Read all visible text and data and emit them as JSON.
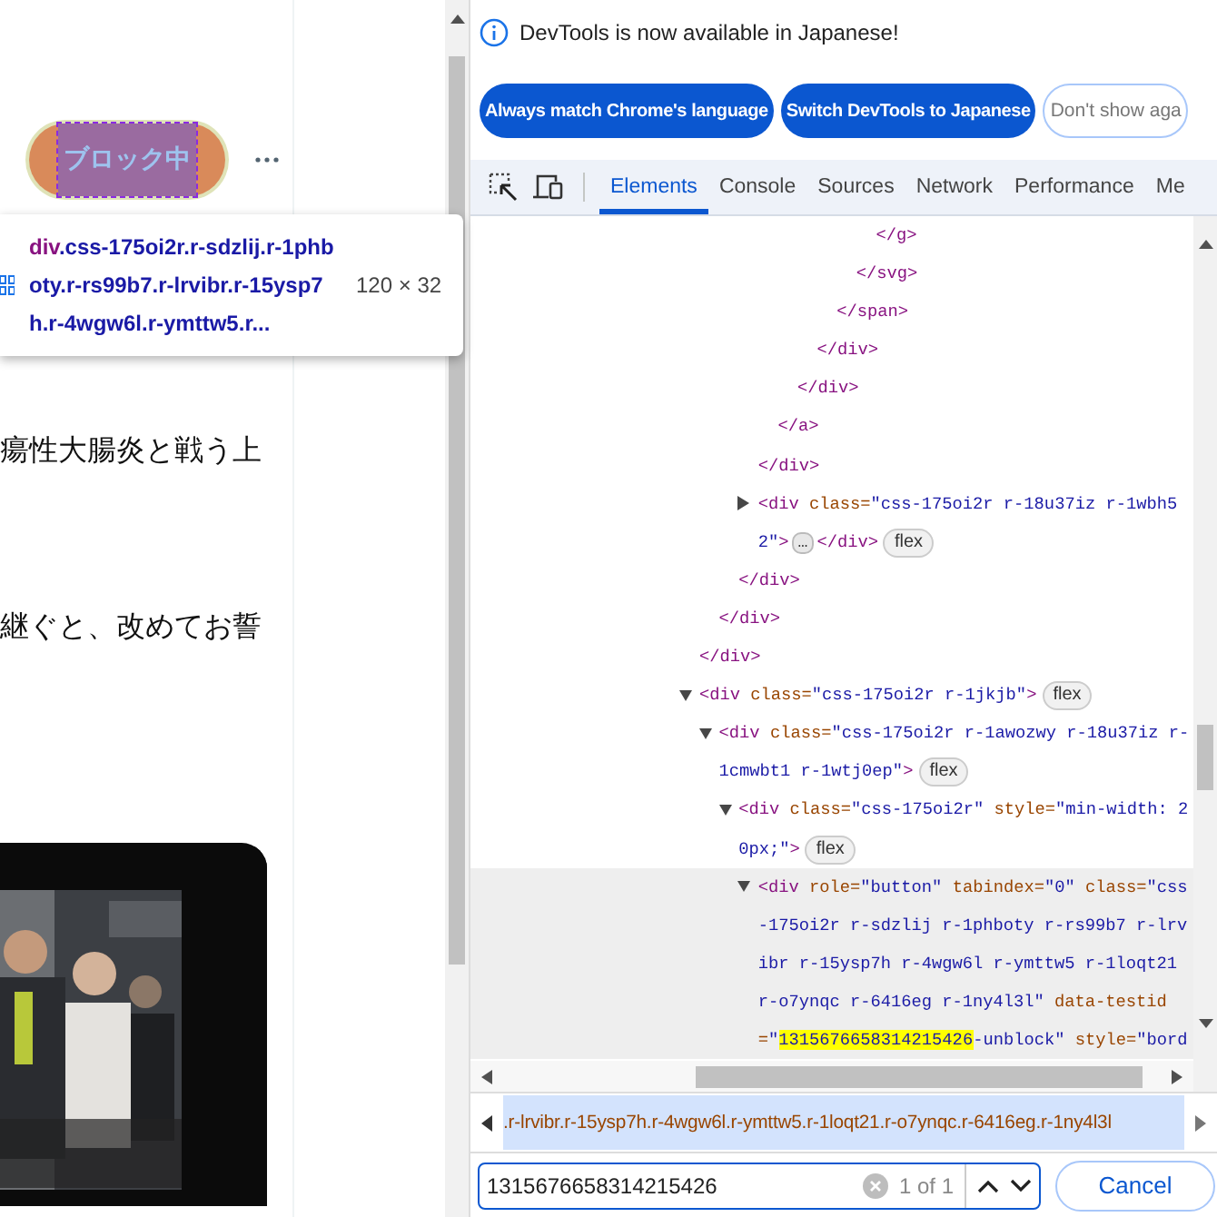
{
  "page": {
    "block_button": "ブロック中",
    "tooltip": {
      "tag": "div",
      "classes": ".css-175oi2r.r-sdzlij.r-1phboty.r-rs99b7.r-lrvibr.r-15ysp7h.r-4wgw6l.r-ymttw5.r...",
      "size": "120 × 32"
    },
    "post_lines": [
      "瘍性大腸炎と戦う上",
      "継ぐと、改めてお誓"
    ],
    "video": {
      "kind": "picture"
    }
  },
  "devtools": {
    "notice": {
      "message": "DevTools is now available in Japanese!",
      "buttons": [
        {
          "label": "Always match Chrome's language",
          "kind": "primary"
        },
        {
          "label": "Switch DevTools to Japanese",
          "kind": "primary"
        },
        {
          "label": "Don't show aga",
          "kind": "outline"
        }
      ]
    },
    "tabs": [
      {
        "label": "Elements",
        "selected": true
      },
      {
        "label": "Console",
        "selected": false
      },
      {
        "label": "Sources",
        "selected": false
      },
      {
        "label": "Network",
        "selected": false
      },
      {
        "label": "Performance",
        "selected": false
      },
      {
        "label": "Me",
        "selected": false
      }
    ],
    "tree": [
      {
        "children": [
          {
            "children": [
              {
                "children": [
                  {
                    "children": [
                      {
                        "children": [
                          {
                            "children": [
                              {
                                "children": [
                                  {
                                    "children": [
                                      {
                                        "children": [
                                          {
                                            "tokens": [
                                              {
                                                "kind": "tag",
                                                "text": "</g>"
                                              }
                                            ]
                                          }
                                        ]
                                      },
                                      {
                                        "tokens": [
                                          {
                                            "kind": "tag",
                                            "text": "</svg>"
                                          }
                                        ]
                                      }
                                    ]
                                  },
                                  {
                                    "tokens": [
                                      {
                                        "kind": "tag",
                                        "text": "</span>"
                                      }
                                    ]
                                  }
                                ]
                              },
                              {
                                "tokens": [
                                  {
                                    "kind": "tag",
                                    "text": "</div>"
                                  }
                                ]
                              }
                            ]
                          },
                          {
                            "tokens": [
                              {
                                "kind": "tag",
                                "text": "</div>"
                              }
                            ]
                          }
                        ]
                      },
                      {
                        "tokens": [
                          {
                            "kind": "tag",
                            "text": "</a>"
                          }
                        ]
                      }
                    ]
                  },
                  {
                    "tokens": [
                      {
                        "kind": "tag",
                        "text": "</div>"
                      }
                    ]
                  },
                  {
                    "expanded": false,
                    "tokens": [
                      {
                        "kind": "tag",
                        "text": "<div"
                      },
                      {
                        "kind": "attr",
                        "text": " class="
                      },
                      {
                        "kind": "value",
                        "text": "\"css-175oi2r r-18u37iz r-1wbh52\""
                      },
                      {
                        "kind": "tag",
                        "text": ">"
                      },
                      {
                        "kind": "ellipsis",
                        "text": "…"
                      },
                      {
                        "kind": "tag",
                        "text": "</div>"
                      },
                      {
                        "kind": "badge",
                        "text": "flex"
                      }
                    ]
                  }
                ]
              },
              {
                "tokens": [
                  {
                    "kind": "tag",
                    "text": "</div>"
                  }
                ]
              }
            ]
          },
          {
            "tokens": [
              {
                "kind": "tag",
                "text": "</div>"
              }
            ]
          }
        ]
      },
      {
        "tokens": [
          {
            "kind": "tag",
            "text": "</div>"
          }
        ]
      },
      {
        "expanded": true,
        "tokens": [
          {
            "kind": "tag",
            "text": "<div"
          },
          {
            "kind": "attr",
            "text": " class="
          },
          {
            "kind": "value",
            "text": "\"css-175oi2r r-1jkjb\""
          },
          {
            "kind": "tag",
            "text": ">"
          },
          {
            "kind": "badge",
            "text": "flex"
          }
        ],
        "children": [
          {
            "expanded": true,
            "tokens": [
              {
                "kind": "tag",
                "text": "<div"
              },
              {
                "kind": "attr",
                "text": " class="
              },
              {
                "kind": "value",
                "text": "\"css-175oi2r r-1awozwy r-18u37iz r-1cmwbt1 r-1wtj0ep\""
              },
              {
                "kind": "tag",
                "text": ">"
              },
              {
                "kind": "badge",
                "text": "flex"
              }
            ],
            "children": [
              {
                "expanded": true,
                "tokens": [
                  {
                    "kind": "tag",
                    "text": "<div"
                  },
                  {
                    "kind": "attr",
                    "text": " class="
                  },
                  {
                    "kind": "value",
                    "text": "\"css-175oi2r\""
                  },
                  {
                    "kind": "attr",
                    "text": " style="
                  },
                  {
                    "kind": "value",
                    "text": "\"min-width: 20px;\""
                  },
                  {
                    "kind": "tag",
                    "text": ">"
                  },
                  {
                    "kind": "badge",
                    "text": "flex"
                  }
                ],
                "children": [
                  {
                    "expanded": true,
                    "selected": true,
                    "tokens": [
                      {
                        "kind": "tag",
                        "text": "<div"
                      },
                      {
                        "kind": "attr",
                        "text": " role="
                      },
                      {
                        "kind": "value",
                        "text": "\"button\""
                      },
                      {
                        "kind": "attr",
                        "text": " tabindex="
                      },
                      {
                        "kind": "value",
                        "text": "\"0\""
                      },
                      {
                        "kind": "attr",
                        "text": " class="
                      },
                      {
                        "kind": "value",
                        "text": "\"css-175oi2r r-sdzlij r-1phboty r-rs99b7 r-lrvibr r-15ysp7h r-4wgw6l r-ymttw5 r-1loqt21 r-o7ynqc r-6416eg r-1ny4l3l\""
                      },
                      {
                        "kind": "attr",
                        "text": " data-testid="
                      },
                      {
                        "kind": "value",
                        "text": "\""
                      },
                      {
                        "kind": "highlight",
                        "text": "1315676658314215426"
                      },
                      {
                        "kind": "value",
                        "text": "-unblock\""
                      },
                      {
                        "kind": "attr",
                        "text": " style="
                      },
                      {
                        "kind": "value",
                        "text": "\"bord"
                      }
                    ]
                  }
                ]
              }
            ]
          }
        ]
      }
    ],
    "breadcrumb": ".r-lrvibr.r-15ysp7h.r-4wgw6l.r-ymttw5.r-1loqt21.r-o7ynqc.r-6416eg.r-1ny4l3l",
    "search": {
      "value": "1315676658314215426",
      "match_count": "1 of 1",
      "cancel": "Cancel"
    }
  }
}
